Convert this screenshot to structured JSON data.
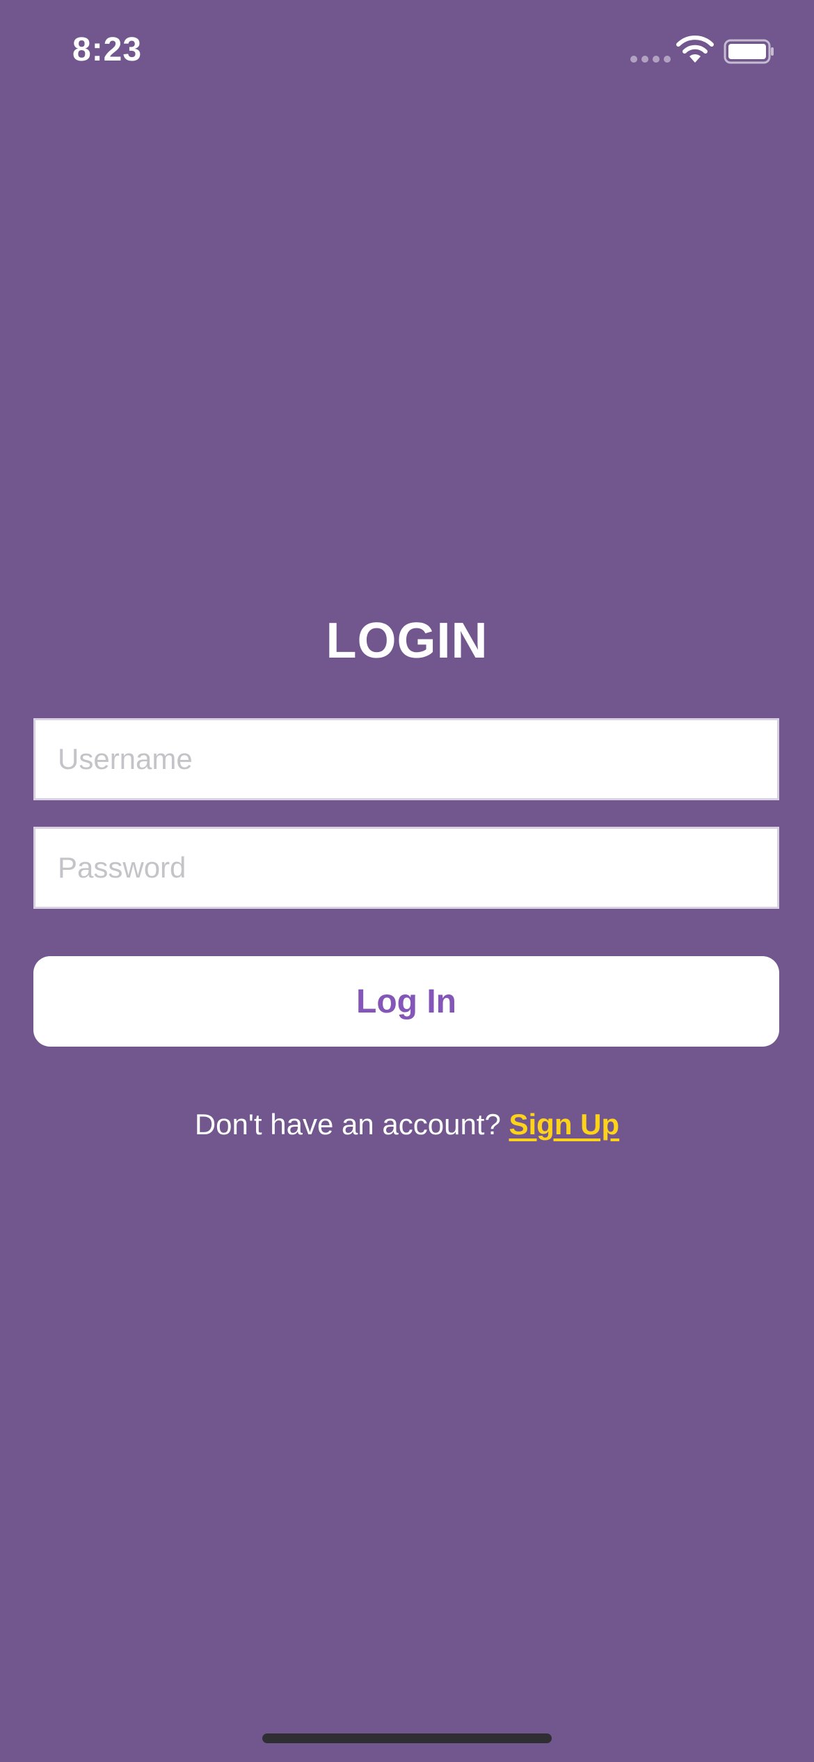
{
  "status_bar": {
    "time": "8:23"
  },
  "login": {
    "title": "LOGIN",
    "username_placeholder": "Username",
    "password_placeholder": "Password",
    "login_button_label": "Log In",
    "signup_prompt": "Don't have an account?",
    "signup_link_label": "Sign Up"
  },
  "colors": {
    "background": "#72578f",
    "button_text": "#8356b8",
    "link": "#ffd319"
  }
}
